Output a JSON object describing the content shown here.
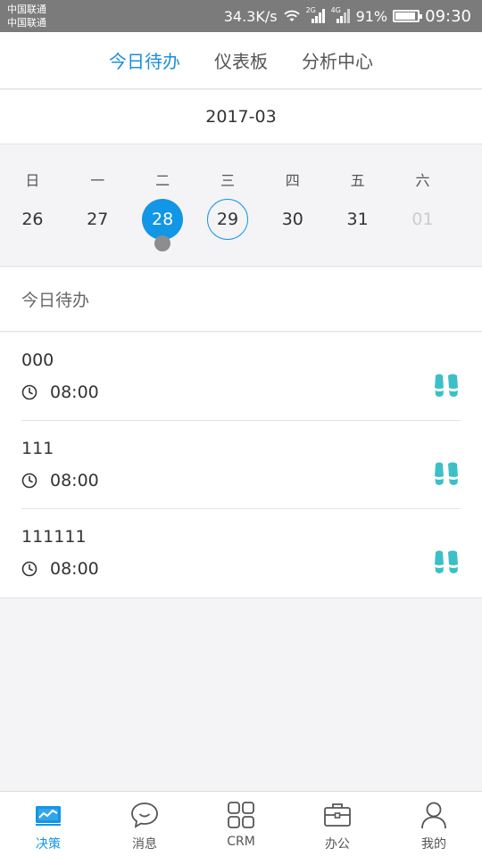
{
  "status_bar": {
    "carrier1": "中国联通",
    "carrier2": "中国联通",
    "speed": "34.3K/s",
    "net1": "2G",
    "net2": "4G",
    "battery": "91%",
    "battery_level": 0.91,
    "time": "09:30"
  },
  "top_tabs": [
    {
      "label": "今日待办",
      "active": true
    },
    {
      "label": "仪表板",
      "active": false
    },
    {
      "label": "分析中心",
      "active": false
    }
  ],
  "calendar": {
    "month": "2017-03",
    "weekdays": [
      "日",
      "一",
      "二",
      "三",
      "四",
      "五",
      "六"
    ],
    "days": [
      {
        "num": "26",
        "state": "normal"
      },
      {
        "num": "27",
        "state": "normal"
      },
      {
        "num": "28",
        "state": "selected",
        "has_event": true
      },
      {
        "num": "29",
        "state": "today"
      },
      {
        "num": "30",
        "state": "normal"
      },
      {
        "num": "31",
        "state": "normal"
      },
      {
        "num": "01",
        "state": "muted"
      }
    ]
  },
  "section_title": "今日待办",
  "todos": [
    {
      "title": "000",
      "time": "08:00",
      "icon": "footprints-icon"
    },
    {
      "title": "111",
      "time": "08:00",
      "icon": "footprints-icon"
    },
    {
      "title": "111111",
      "time": "08:00",
      "icon": "footprints-icon"
    }
  ],
  "bottom_nav": [
    {
      "label": "决策",
      "icon": "chart-screen-icon",
      "active": true
    },
    {
      "label": "消息",
      "icon": "chat-bubble-icon",
      "active": false
    },
    {
      "label": "CRM",
      "icon": "grid-icon",
      "active": false
    },
    {
      "label": "办公",
      "icon": "briefcase-icon",
      "active": false
    },
    {
      "label": "我的",
      "icon": "user-icon",
      "active": false
    }
  ],
  "colors": {
    "accent": "#1296e6",
    "feet": "#3cc0c8",
    "status_bar": "#7b7b7b"
  }
}
